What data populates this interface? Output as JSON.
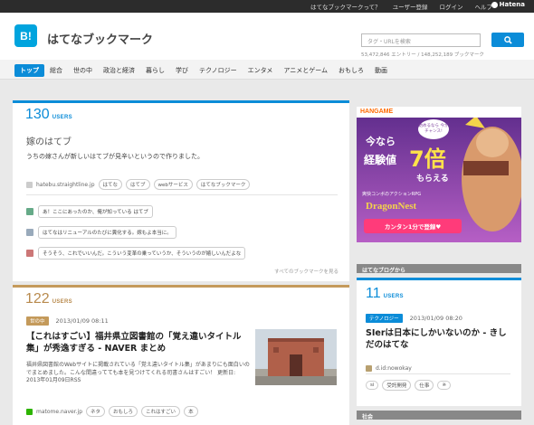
{
  "topbar": {
    "links": [
      "はてなブックマークって？",
      "ユーザー登録",
      "ログイン",
      "ヘルプ"
    ],
    "brand": "Hatena"
  },
  "header": {
    "logo_text": "B!",
    "brand_name": "はてなブックマーク",
    "search_placeholder": "タグ・URLを検索",
    "stats": "53,472,846 エントリー / 148,252,189 ブックマーク"
  },
  "nav": {
    "tabs": [
      "トップ",
      "総合",
      "世の中",
      "政治と経済",
      "暮らし",
      "学び",
      "テクノロジー",
      "エンタメ",
      "アニメとゲーム",
      "おもしろ",
      "動画"
    ],
    "active": "トップ"
  },
  "entries": [
    {
      "users": "130",
      "users_label": "USERS",
      "title": "嫁のはてブ",
      "description": "うちの嫁さんが新しいはてブが見辛いというので作りました。",
      "source": "hatebu.straightline.jp",
      "tags": [
        "はてな",
        "はてブ",
        "webサービス",
        "はてなブックマーク"
      ],
      "comments": [
        "あ！ここにあったのか、俺が知っている はてブ",
        "はてなはリニューアルのたびに糞化する。嫁もよ本当に。",
        "そうそう、これでいいんだ。こういう変革の乗っていうか、そういうのが嬉しいんだよな"
      ],
      "all_comments": "すべてのブックマークを見る"
    },
    {
      "users": "122",
      "users_label": "USERS",
      "category": "世の中",
      "date": "2013/01/09 08:11",
      "title": "【これはすごい】福井県立図書館の「覚え違いタイトル集」が秀逸すぎる - NAVER まとめ",
      "description": "福井県図書館のWebサイトに掲載されている「覚え違いタイトル集」があまりにも面白いのでまとめました。こんな間違ってても本を見つけてくれる司書さんはすごい！ 更新日: 2013年01月09日RSS",
      "source": "matome.naver.jp",
      "tags": [
        "ネタ",
        "おもしろ",
        "これはすごい",
        "本"
      ]
    }
  ],
  "sidebar": {
    "ad": {
      "brand": "HANGAME",
      "line1": "今なら",
      "line2": "経験値",
      "big": "7倍",
      "line3": "もらえる",
      "bubble": "始めるなら 今がチャンス!",
      "sub": "爽快コンボのアクションRPG",
      "game": "DragonNest",
      "button": "カンタン1分で登録♥"
    },
    "section_title": "はてなブログから",
    "entry": {
      "users": "11",
      "users_label": "USERS",
      "category": "テクノロジー",
      "date": "2013/01/09 08:20",
      "title": "SIerは日本にしかいないのか - きしだのはてな",
      "source": "d.id:nowokay",
      "tags": [
        "si",
        "受託開発",
        "仕事",
        "※"
      ]
    },
    "section2_title": "社会"
  },
  "colors": {
    "accent": "#0b8cd8",
    "brown": "#c49a5b",
    "topbar": "#2c2c2c"
  }
}
